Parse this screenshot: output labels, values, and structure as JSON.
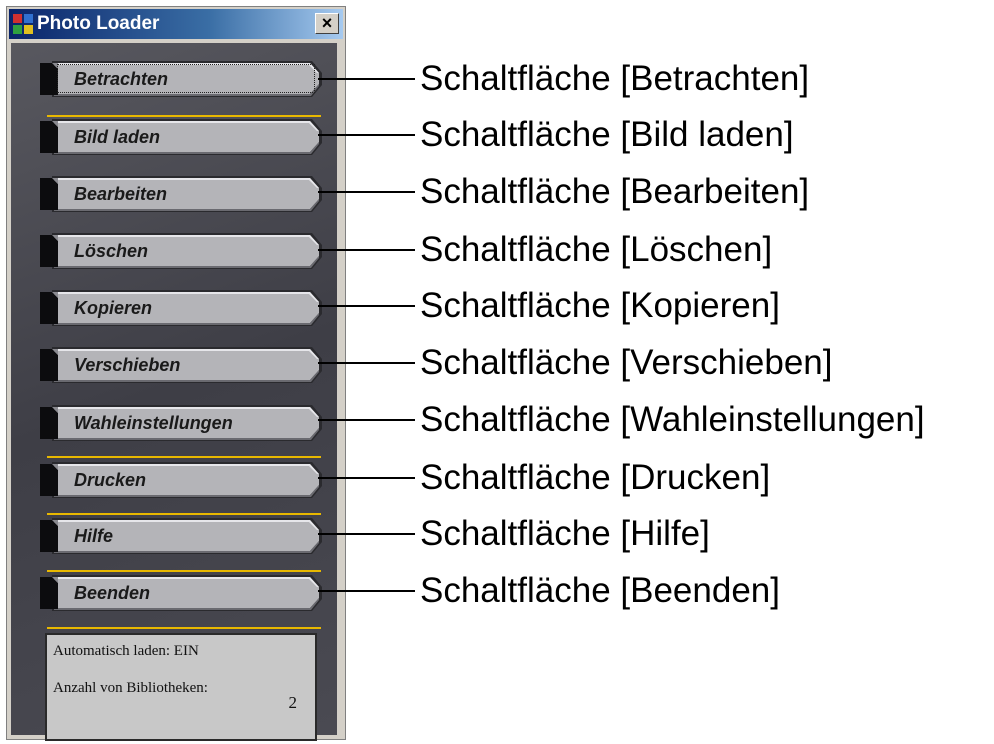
{
  "window": {
    "title": "Photo Loader",
    "close_glyph": "×"
  },
  "buttons": [
    {
      "id": "betrachten",
      "label": "Betrachten",
      "focused": true
    },
    {
      "id": "bild-laden",
      "label": "Bild laden",
      "focused": false
    },
    {
      "id": "bearbeiten",
      "label": "Bearbeiten",
      "focused": false
    },
    {
      "id": "loeschen",
      "label": "Löschen",
      "focused": false
    },
    {
      "id": "kopieren",
      "label": "Kopieren",
      "focused": false
    },
    {
      "id": "verschieben",
      "label": "Verschieben",
      "focused": false
    },
    {
      "id": "wahleinstellungen",
      "label": "Wahleinstellungen",
      "focused": false
    },
    {
      "id": "drucken",
      "label": "Drucken",
      "focused": false
    },
    {
      "id": "hilfe",
      "label": "Hilfe",
      "focused": false
    },
    {
      "id": "beenden",
      "label": "Beenden",
      "focused": false
    }
  ],
  "status": {
    "auto_load": "Automatisch laden:  EIN",
    "library_count_label": "Anzahl von Bibliotheken:",
    "library_count": "2"
  },
  "callouts": [
    "Schaltfläche [Betrachten]",
    "Schaltfläche [Bild laden]",
    "Schaltfläche [Bearbeiten]",
    "Schaltfläche [Löschen]",
    "Schaltfläche [Kopieren]",
    "Schaltfläche [Verschieben]",
    "Schaltfläche [Wahleinstellungen]",
    "Schaltfläche [Drucken]",
    "Schaltfläche [Hilfe]",
    "Schaltfläche [Beenden]"
  ],
  "colors": {
    "panel": "#46464e",
    "button_face": "#b4b4b8",
    "separator": "#e8b800",
    "title_bar": "#0a246a"
  }
}
